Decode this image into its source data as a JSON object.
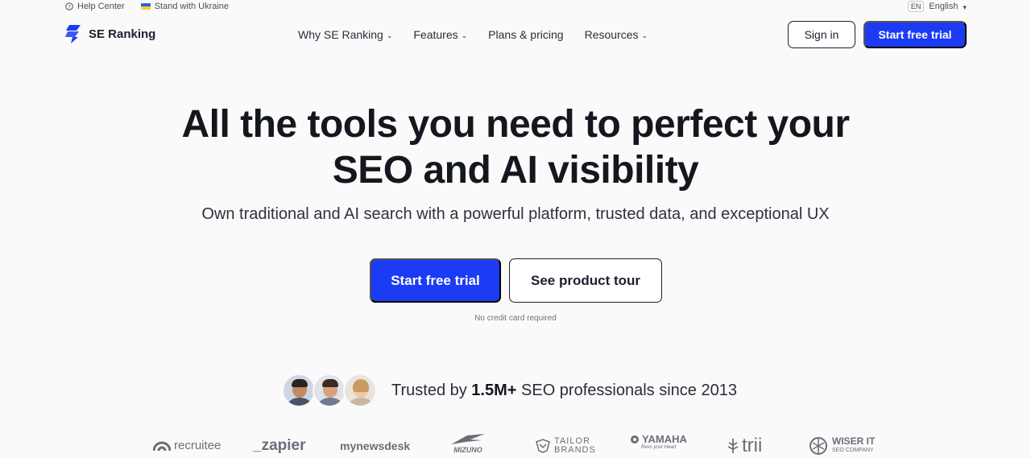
{
  "topbar": {
    "help_label": "Help Center",
    "ukraine_label": "Stand with Ukraine",
    "lang_code": "EN",
    "lang_label": "English"
  },
  "header": {
    "logo_text": "SE Ranking",
    "menu": [
      {
        "label": "Why SE Ranking",
        "has_dropdown": true
      },
      {
        "label": "Features",
        "has_dropdown": true
      },
      {
        "label": "Plans & pricing",
        "has_dropdown": false
      },
      {
        "label": "Resources",
        "has_dropdown": true
      }
    ],
    "signin_label": "Sign in",
    "trial_label": "Start free trial"
  },
  "hero": {
    "title_line1": "All the tools you need to perfect your",
    "title_line2": "SEO and AI visibility",
    "subtitle": "Own traditional and AI search with a powerful platform, trusted data, and exceptional UX",
    "primary_cta": "Start free trial",
    "secondary_cta": "See product tour",
    "note": "No credit card required"
  },
  "trust": {
    "prefix": "Trusted by ",
    "count": "1.5M+",
    "suffix": " SEO professionals since 2013"
  },
  "logos": [
    {
      "name": "recruitee"
    },
    {
      "name": "_zapier"
    },
    {
      "name": "mynewsdesk"
    },
    {
      "name": "MIZUNO"
    },
    {
      "name": "TAILOR",
      "sub": "BRANDS"
    },
    {
      "name": "YAMAHA",
      "sub": "Revs your Heart"
    },
    {
      "name": "trii"
    },
    {
      "name": "WISER IT",
      "sub": "SEO COMPANY"
    }
  ],
  "colors": {
    "accent": "#1c3bf5",
    "text_dark": "#15171f",
    "background": "#fafafa"
  }
}
